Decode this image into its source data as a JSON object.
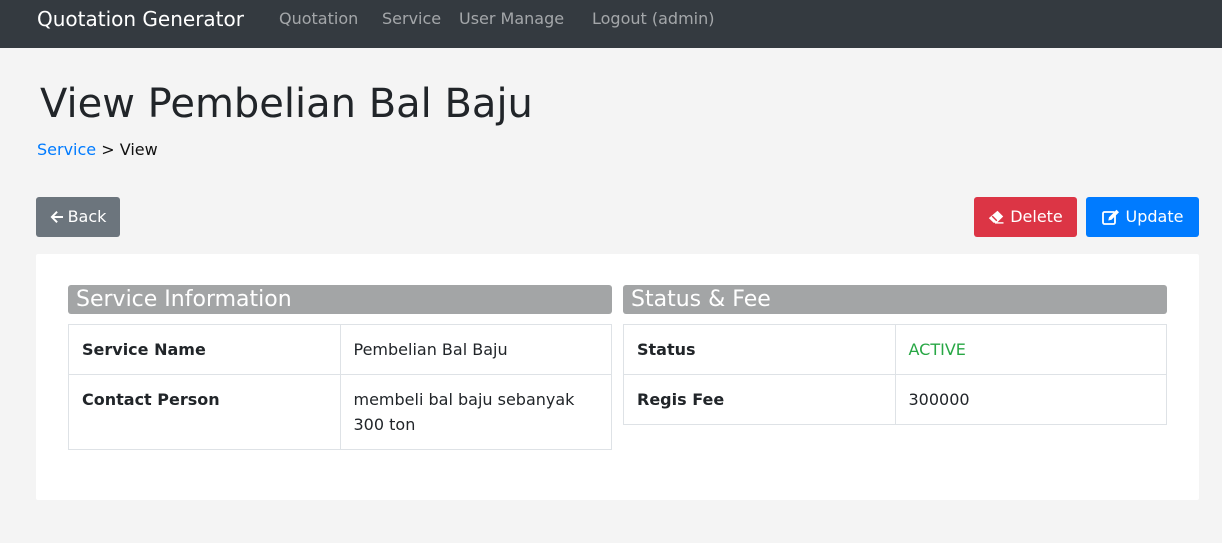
{
  "navbar": {
    "brand": "Quotation Generator",
    "links": [
      {
        "label": "Quotation"
      },
      {
        "label": "Service"
      },
      {
        "label": "User Manage"
      },
      {
        "label": "Logout (admin)"
      }
    ]
  },
  "page": {
    "title": "View Pembelian Bal Baju",
    "breadcrumb": {
      "link": "Service",
      "separator": " > ",
      "current": "View"
    }
  },
  "actions": {
    "back_label": "Back",
    "delete_label": "Delete",
    "update_label": "Update"
  },
  "service_info": {
    "header": "Service Information",
    "rows": [
      {
        "key": "Service Name",
        "value": "Pembelian Bal Baju"
      },
      {
        "key": "Contact Person",
        "value": "membeli bal baju sebanyak 300 ton"
      }
    ]
  },
  "status_fee": {
    "header": "Status & Fee",
    "rows": [
      {
        "key": "Status",
        "value": "ACTIVE"
      },
      {
        "key": "Regis Fee",
        "value": "300000"
      }
    ]
  },
  "colors": {
    "navbar_bg": "#343a40",
    "primary": "#007bff",
    "danger": "#dc3545",
    "secondary": "#6c757d",
    "success": "#28a745",
    "section_header_bg": "#a3a5a6"
  },
  "icons": {
    "back": "arrow-left-icon",
    "delete": "eraser-icon",
    "update": "edit-icon"
  }
}
